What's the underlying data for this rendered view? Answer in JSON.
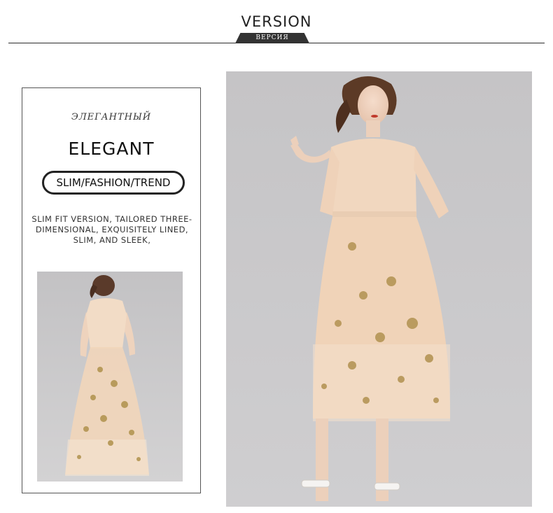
{
  "header": {
    "title": "VERSION",
    "badge": "ВЕРСИЯ"
  },
  "info_panel": {
    "subtitle": "ЭЛЕГАНТНЫЙ",
    "title": "ELEGANT",
    "tags": "SLIM/FASHION/TREND",
    "description_lines": [
      "SLIM FIT VERSION, TAILORED THREE-",
      "DIMENSIONAL, EXQUISITELY LINED,",
      "SLIM, AND SLEEK,"
    ]
  },
  "colors": {
    "accent_dark": "#333333",
    "photo_background": "#c9c8ca",
    "dress": "#f0d7bf",
    "embroidery_gold": "#b59556"
  },
  "images": {
    "back_view": "model-back-view-photo",
    "front_view": "model-front-view-photo"
  }
}
